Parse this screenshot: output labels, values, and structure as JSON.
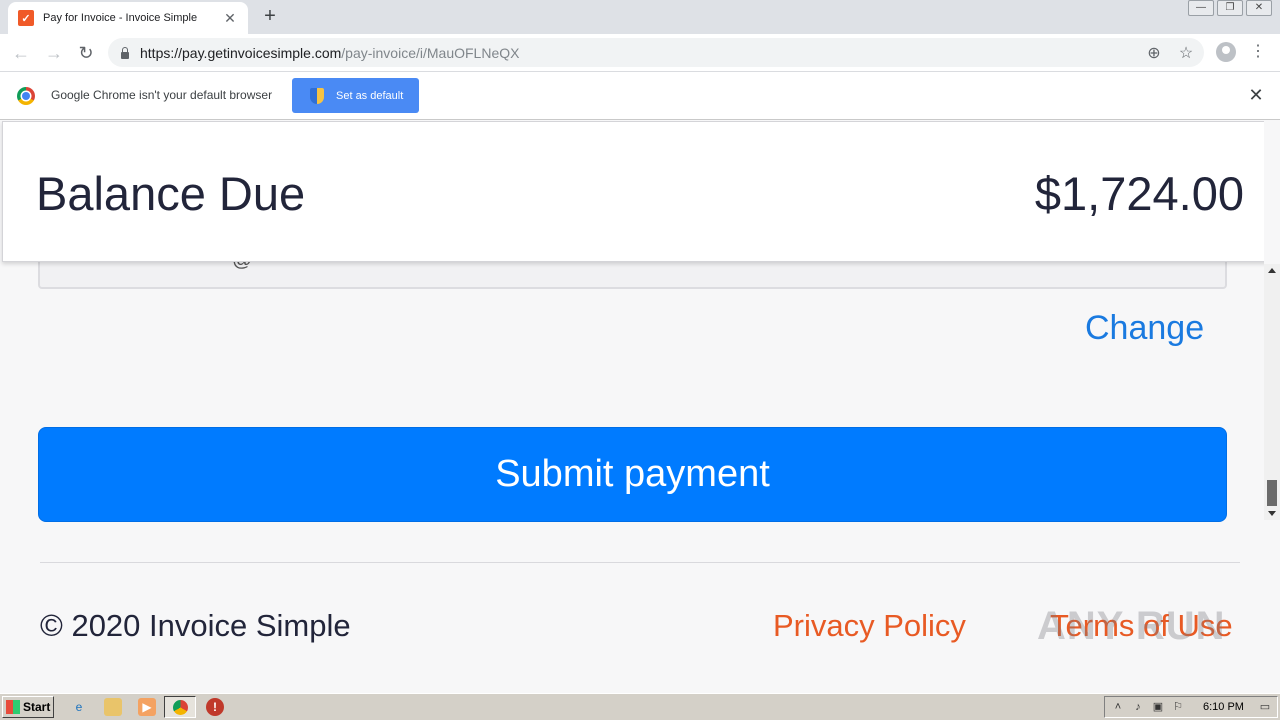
{
  "browser": {
    "tab": {
      "title": "Pay for Invoice - Invoice Simple",
      "close_glyph": "✕"
    },
    "new_tab_glyph": "+",
    "window_controls": {
      "minimize": "—",
      "restore": "❐",
      "close": "✕"
    },
    "nav": {
      "back": "←",
      "forward": "→",
      "reload": "↻"
    },
    "url": {
      "host": "https://pay.getinvoicesimple.com",
      "path": "/pay-invoice/i/MauOFLNeQX"
    },
    "omnibox_icons": {
      "zoom": "⊕",
      "bookmark": "☆"
    },
    "menu_glyph": "⋮"
  },
  "infobar": {
    "message": "Google Chrome isn't your default browser",
    "button_label": "Set as default",
    "close_glyph": "✕"
  },
  "page": {
    "balance": {
      "label": "Balance Due",
      "amount": "$1,724.00"
    },
    "card_glyph": "@",
    "change_link": "Change",
    "submit_label": "Submit payment",
    "footer": {
      "copyright": "© 2020 Invoice Simple",
      "privacy": "Privacy Policy",
      "terms": "Terms of Use"
    },
    "colors": {
      "primary": "#007bff",
      "link": "#1a7ae0",
      "footer_link": "#e85a24",
      "text": "#22253a"
    }
  },
  "watermark": "ANY RUN",
  "taskbar": {
    "start_label": "Start",
    "clock": "6:10 PM"
  }
}
